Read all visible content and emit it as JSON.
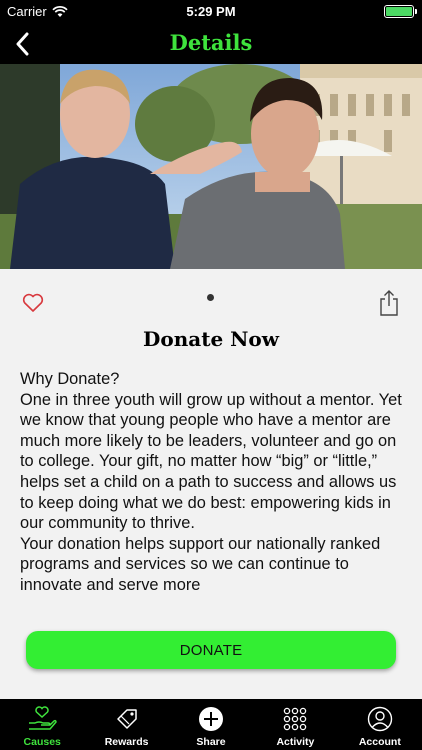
{
  "status": {
    "carrier": "Carrier",
    "time": "5:29 PM",
    "battery_color": "#4cd964"
  },
  "nav": {
    "title": "Details",
    "back_icon": "chevron-left-icon",
    "title_color": "#3fe33d"
  },
  "hero": {
    "description": "photo"
  },
  "detail": {
    "headline": "Donate Now",
    "paragraphs": [
      "Why Donate?",
      "One in three youth will grow up without a mentor. Yet we know that young people who have a mentor are much more likely to be leaders, volunteer and go on to college. Your gift, no matter how “big” or “little,” helps set a child on a path to success and allows us to keep doing what we do best: empowering kids in our community to thrive.",
      "Your donation helps support our nationally ranked programs and services so we can continue to innovate and serve more"
    ],
    "donate_label": "DONATE",
    "accent": "#33ee33"
  },
  "tabs": [
    {
      "label": "Causes",
      "icon": "hand-heart-icon",
      "active": true
    },
    {
      "label": "Rewards",
      "icon": "tag-icon",
      "active": false
    },
    {
      "label": "Share",
      "icon": "plus-circle-icon",
      "active": false
    },
    {
      "label": "Activity",
      "icon": "grid-dots-icon",
      "active": false
    },
    {
      "label": "Account",
      "icon": "user-circle-icon",
      "active": false
    }
  ]
}
